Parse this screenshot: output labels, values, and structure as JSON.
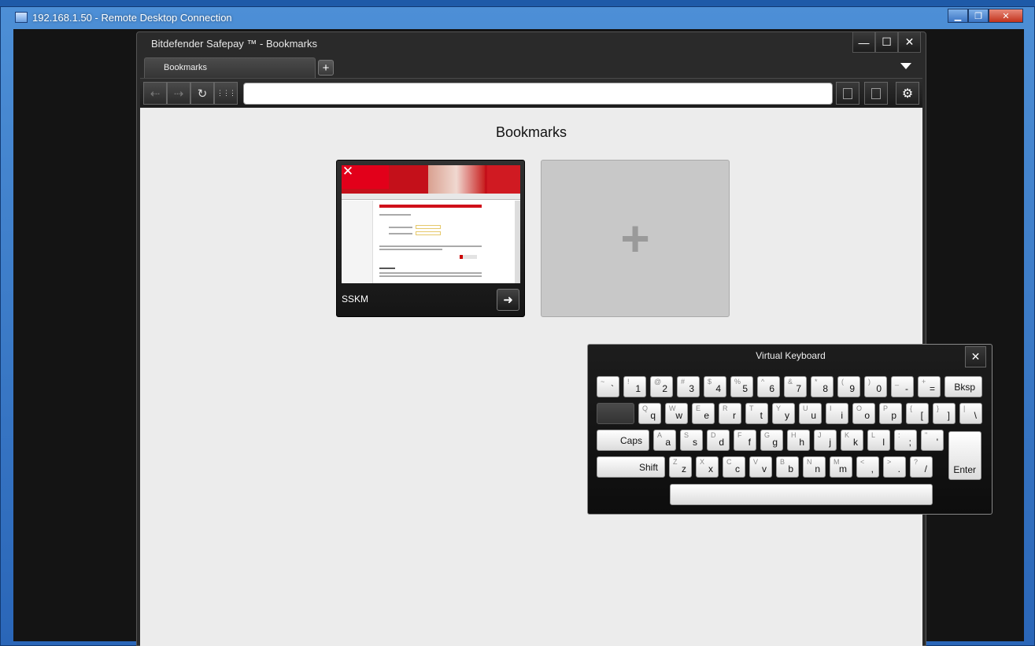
{
  "rdp": {
    "title": "192.168.1.50 - Remote Desktop Connection",
    "minimize": "▁",
    "restore": "❐",
    "close": "✕"
  },
  "window": {
    "title": "Bitdefender Safepay ™ - Bookmarks",
    "min": "—",
    "max": "☐",
    "close": "✕"
  },
  "tabs": [
    {
      "label": "Bookmarks"
    }
  ],
  "new_tab": "+",
  "toolbar": {
    "back": "⇠",
    "forward": "⇢",
    "reload": "↻",
    "apps": "⋮⋮⋮",
    "url": ""
  },
  "content": {
    "heading": "Bookmarks",
    "bookmarks": [
      {
        "label": "SSKM",
        "close": "✕",
        "go": "➜"
      }
    ],
    "add_symbol": "+"
  },
  "keyboard": {
    "title": "Virtual Keyboard",
    "close": "✕",
    "rows": [
      [
        [
          "~",
          "`"
        ],
        [
          "!",
          "1"
        ],
        [
          "@",
          "2"
        ],
        [
          "#",
          "3"
        ],
        [
          "$",
          "4"
        ],
        [
          "%",
          "5"
        ],
        [
          "^",
          "6"
        ],
        [
          "&",
          "7"
        ],
        [
          "*",
          "8"
        ],
        [
          "(",
          "9"
        ],
        [
          ")",
          "0"
        ],
        [
          "_",
          "-"
        ],
        [
          "+",
          "="
        ],
        [
          "",
          "Bksp"
        ]
      ],
      [
        [
          "",
          ""
        ],
        [
          "Q",
          "q"
        ],
        [
          "W",
          "w"
        ],
        [
          "E",
          "e"
        ],
        [
          "R",
          "r"
        ],
        [
          "T",
          "t"
        ],
        [
          "Y",
          "y"
        ],
        [
          "U",
          "u"
        ],
        [
          "I",
          "i"
        ],
        [
          "O",
          "o"
        ],
        [
          "P",
          "p"
        ],
        [
          "{",
          "["
        ],
        [
          "}",
          "]"
        ],
        [
          "|",
          "\\"
        ]
      ],
      [
        [
          "",
          "Caps"
        ],
        [
          "A",
          "a"
        ],
        [
          "S",
          "s"
        ],
        [
          "D",
          "d"
        ],
        [
          "F",
          "f"
        ],
        [
          "G",
          "g"
        ],
        [
          "H",
          "h"
        ],
        [
          "J",
          "j"
        ],
        [
          "K",
          "k"
        ],
        [
          "L",
          "l"
        ],
        [
          ":",
          ";"
        ],
        [
          "\"",
          "'"
        ]
      ],
      [
        [
          "",
          "Shift"
        ],
        [
          "Z",
          "z"
        ],
        [
          "X",
          "x"
        ],
        [
          "C",
          "c"
        ],
        [
          "V",
          "v"
        ],
        [
          "B",
          "b"
        ],
        [
          "N",
          "n"
        ],
        [
          "M",
          "m"
        ],
        [
          "<",
          ","
        ],
        [
          ">",
          "."
        ],
        [
          "?",
          "/"
        ]
      ]
    ],
    "enter": "Enter",
    "space": ""
  }
}
